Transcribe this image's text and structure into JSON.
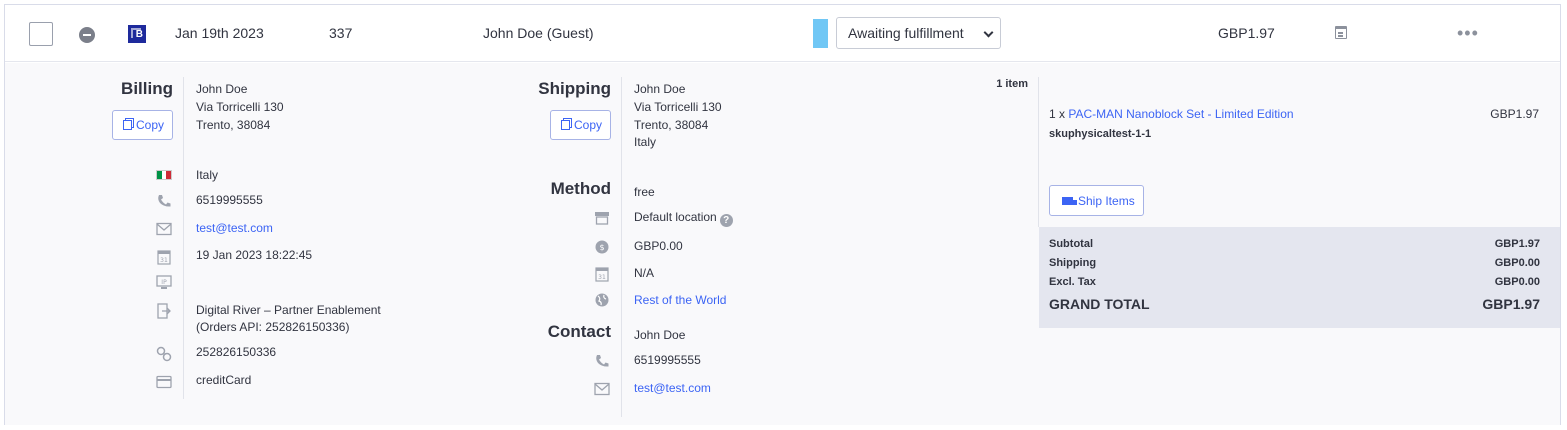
{
  "order": {
    "date": "Jan 19th 2023",
    "id": "337",
    "customer": "John Doe (Guest)",
    "status": "Awaiting fulfillment",
    "status_color": "#70c7f5",
    "total": "GBP1.97"
  },
  "billing": {
    "heading": "Billing",
    "copy_label": "Copy",
    "name": "John Doe",
    "street": "Via Torricelli 130",
    "city": "Trento, 38084",
    "country": "Italy",
    "phone": "6519995555",
    "email": "test@test.com",
    "date": "19 Jan 2023 18:22:45",
    "channel_line1": "Digital River – Partner Enablement",
    "channel_line2": "(Orders API: 252826150336)",
    "external_id": "252826150336",
    "payment": "creditCard"
  },
  "shipping": {
    "heading": "Shipping",
    "copy_label": "Copy",
    "name": "John Doe",
    "street": "Via Torricelli 130",
    "city": "Trento, 38084",
    "country": "Italy",
    "method_heading": "Method",
    "method": "free",
    "location": "Default location",
    "help_label": "?",
    "cost": "GBP0.00",
    "date": "N/A",
    "zone": "Rest of the World",
    "contact_heading": "Contact",
    "contact_name": "John Doe",
    "contact_phone": "6519995555",
    "contact_email": "test@test.com"
  },
  "items": {
    "count": "1 item",
    "qty": "1 x",
    "product": "PAC-MAN Nanoblock Set - Limited Edition",
    "price": "GBP1.97",
    "sku": "skuphysicaltest-1-1",
    "ship_label": "Ship Items"
  },
  "totals": {
    "subtotal_label": "Subtotal",
    "subtotal": "GBP1.97",
    "shipping_label": "Shipping",
    "shipping": "GBP0.00",
    "tax_label": "Excl. Tax",
    "tax": "GBP0.00",
    "grand_label": "GRAND TOTAL",
    "grand": "GBP1.97",
    "background": "#e4e6ef"
  },
  "icons": {
    "row": [
      "checkbox",
      "collapse-icon",
      "channel-icon",
      "calendar-icon",
      "more-icon"
    ],
    "billing": [
      "flag-italy-icon",
      "phone-icon",
      "email-icon",
      "calendar-icon",
      "ip-icon",
      "channel-icon",
      "link-icon",
      "credit-card-icon"
    ],
    "shipping": [
      "store-icon",
      "coin-icon",
      "calendar-icon",
      "globe-icon",
      "phone-icon",
      "email-icon"
    ]
  },
  "colors": {
    "accent": "#3c64f4",
    "text": "#313440",
    "muted": "#8c919c"
  }
}
